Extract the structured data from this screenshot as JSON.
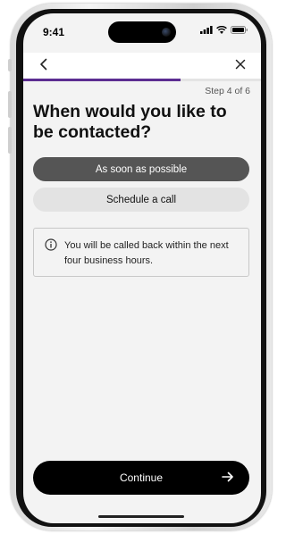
{
  "status_bar": {
    "time": "9:41"
  },
  "nav": {
    "back_icon": "chevron-left-icon",
    "close_icon": "close-icon"
  },
  "progress": {
    "fraction": 0.66,
    "step_label": "Step 4 of 6",
    "color": "#5c2d91"
  },
  "title": "When would you like to be contacted?",
  "options": [
    {
      "label": "As soon as possible",
      "selected": true
    },
    {
      "label": "Schedule a call",
      "selected": false
    }
  ],
  "info": {
    "icon": "info-icon",
    "text": "You will be called back within the next four business hours."
  },
  "continue_button": {
    "label": "Continue",
    "icon": "arrow-right-icon"
  }
}
